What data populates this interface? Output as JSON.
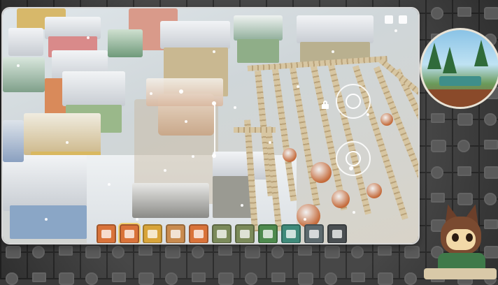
{
  "window": {
    "accent": "#f0d070",
    "frame_border": "#d8d8d8"
  },
  "toolbar": {
    "tools": [
      {
        "icon": "house-icon",
        "color": "orange"
      },
      {
        "icon": "path-icon",
        "color": "orange"
      },
      {
        "icon": "window-frame-icon",
        "color": "gold"
      },
      {
        "icon": "paint-palette-icon",
        "color": "tan"
      },
      {
        "icon": "roof-brush-icon",
        "color": "orange"
      },
      {
        "icon": "flag-icon",
        "color": "sage"
      },
      {
        "icon": "flower-icon",
        "color": "sage"
      },
      {
        "icon": "tree-icon",
        "color": "green"
      },
      {
        "icon": "water-drop-icon",
        "color": "teal"
      },
      {
        "icon": "camera-icon",
        "color": "slate"
      },
      {
        "icon": "settings-ring-icon",
        "color": "dark"
      }
    ],
    "selected_index": 1
  },
  "viewport": {
    "top_icons": [
      "book-icon",
      "gear-icon"
    ],
    "overlay": {
      "rotate_handle": "rotate-ring-icon",
      "scale_handle": "scale-ring-icon",
      "lock": "lock-icon"
    }
  },
  "overlays": {
    "webcam": "streamer-webcam",
    "mascot": "cat-mascot-avatar"
  }
}
